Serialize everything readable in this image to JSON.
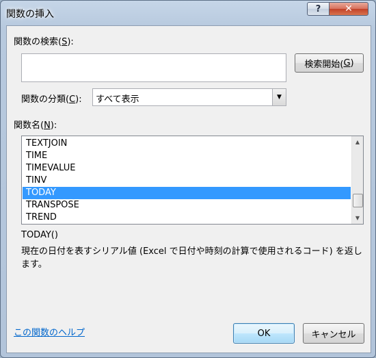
{
  "window": {
    "title": "関数の挿入",
    "help_glyph": "?",
    "close_glyph": "✕"
  },
  "search": {
    "label": "関数の検索(",
    "label_key": "S",
    "label_suffix": "):",
    "value": "",
    "button_label": "検索開始(",
    "button_key": "G",
    "button_suffix": ")"
  },
  "category": {
    "label": "関数の分類(",
    "label_key": "C",
    "label_suffix": "):",
    "selected": "すべて表示",
    "arrow_glyph": "▼"
  },
  "function_list": {
    "label": "関数名(",
    "label_key": "N",
    "label_suffix": "):",
    "items": [
      "TEXTJOIN",
      "TIME",
      "TIMEVALUE",
      "TINV",
      "TODAY",
      "TRANSPOSE",
      "TREND"
    ],
    "selected_index": 4,
    "scroll_up_glyph": "▲",
    "scroll_down_glyph": "▼"
  },
  "details": {
    "signature": "TODAY()",
    "description": "現在の日付を表すシリアル値 (Excel で日付や時刻の計算で使用されるコード) を返します。"
  },
  "footer": {
    "help_link": "この関数のヘルプ",
    "ok_label": "OK",
    "cancel_label": "キャンセル"
  },
  "colors": {
    "selection": "#3399ff",
    "link": "#0066cc"
  }
}
